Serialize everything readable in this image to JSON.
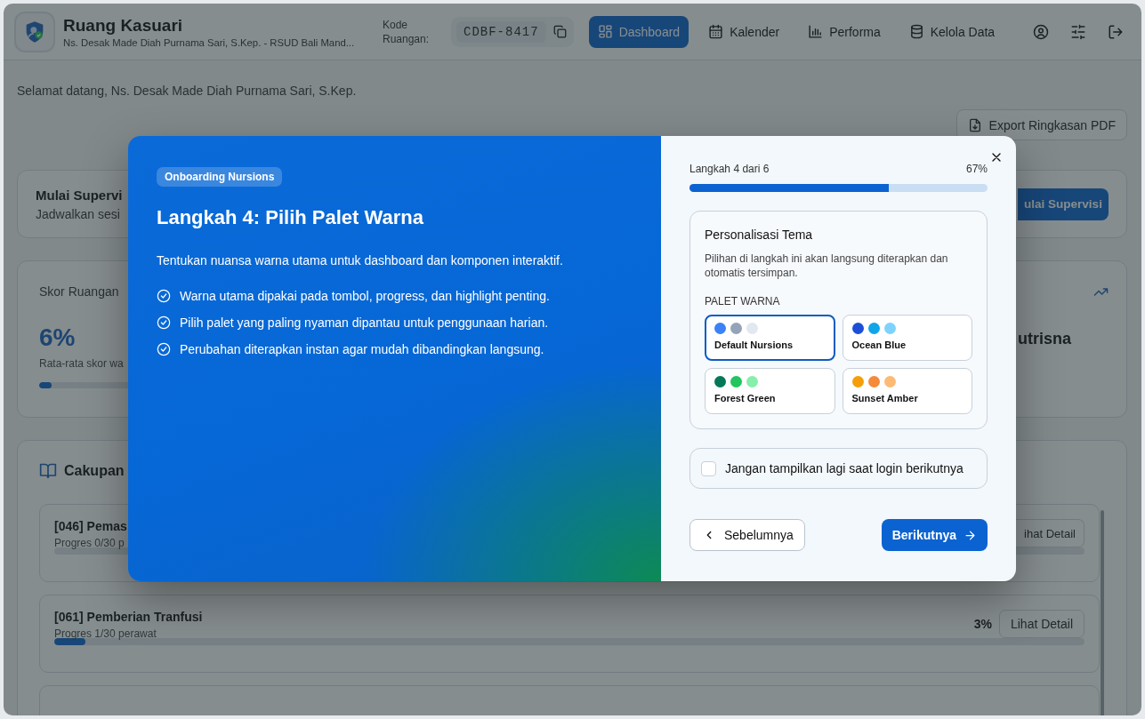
{
  "header": {
    "title": "Ruang Kasuari",
    "subtitle": "Ns. Desak Made Diah Purnama Sari, S.Kep. - RSUD Bali Mand...",
    "code_label": "Kode Ruangan:",
    "room_code": "CDBF-8417",
    "nav": [
      {
        "label": "Dashboard",
        "selected": true
      },
      {
        "label": "Kalender",
        "selected": false
      },
      {
        "label": "Performa",
        "selected": false
      },
      {
        "label": "Kelola Data",
        "selected": false
      }
    ]
  },
  "welcome": "Selamat datang, Ns. Desak Made Diah Purnama Sari, S.Kep.",
  "export_button": "Export Ringkasan PDF",
  "supervision_card": {
    "title": "Mulai Supervi",
    "subtitle": "Jadwalkan sesi",
    "button": "ulai Supervisi"
  },
  "score_card": {
    "title": "Skor Ruangan",
    "value": "6%",
    "caption": "Rata-rata skor wa",
    "level": 0.06,
    "name_fragment": "utrisna"
  },
  "coverage": {
    "title": "Cakupan",
    "items": [
      {
        "title": "[046] Pemas",
        "progress": "Progres 0/30 p",
        "button": "ihat Detail",
        "level": 0
      },
      {
        "title": "[061] Pemberian Tranfusi",
        "progress": "Progres 1/30 perawat",
        "percent": "3%",
        "button": "Lihat Detail",
        "level": 0.03
      }
    ]
  },
  "modal": {
    "badge": "Onboarding Nursions",
    "title": "Langkah 4: Pilih Palet Warna",
    "description": "Tentukan nuansa warna utama untuk dashboard dan komponen interaktif.",
    "points": [
      "Warna utama dipakai pada tombol, progress, dan highlight penting.",
      "Pilih palet yang paling nyaman dipantau untuk penggunaan harian.",
      "Perubahan diterapkan instan agar mudah dibandingkan langsung."
    ],
    "step": "Langkah 4 dari 6",
    "percent": "67%",
    "level": 0.67,
    "theme": {
      "title": "Personalisasi Tema",
      "description": "Pilihan di langkah ini akan langsung diterapkan dan otomatis tersimpan.",
      "palette_label": "PALET WARNA",
      "palettes": [
        {
          "name": "Default Nursions",
          "selected": true,
          "swatches": [
            {
              "color": "#3b82f6"
            },
            {
              "color": "#94a3b8"
            },
            {
              "color": "#e2e8f0"
            }
          ]
        },
        {
          "name": "Ocean Blue",
          "selected": false,
          "swatches": [
            {
              "color": "#1d4ed8"
            },
            {
              "color": "#0ea5e9"
            },
            {
              "color": "#7dd3fc"
            }
          ]
        },
        {
          "name": "Forest Green",
          "selected": false,
          "swatches": [
            {
              "color": "#047857"
            },
            {
              "color": "#22c55e"
            },
            {
              "color": "#86efac"
            }
          ]
        },
        {
          "name": "Sunset Amber",
          "selected": false,
          "swatches": [
            {
              "color": "#f59e0b"
            },
            {
              "color": "#f58a3a"
            },
            {
              "color": "#fdba74"
            }
          ]
        }
      ]
    },
    "dont_show": {
      "label": "Jangan tampilkan lagi saat login berikutnya",
      "checked": false
    },
    "back_button": "Sebelumnya",
    "next_button": "Berikutnya"
  }
}
